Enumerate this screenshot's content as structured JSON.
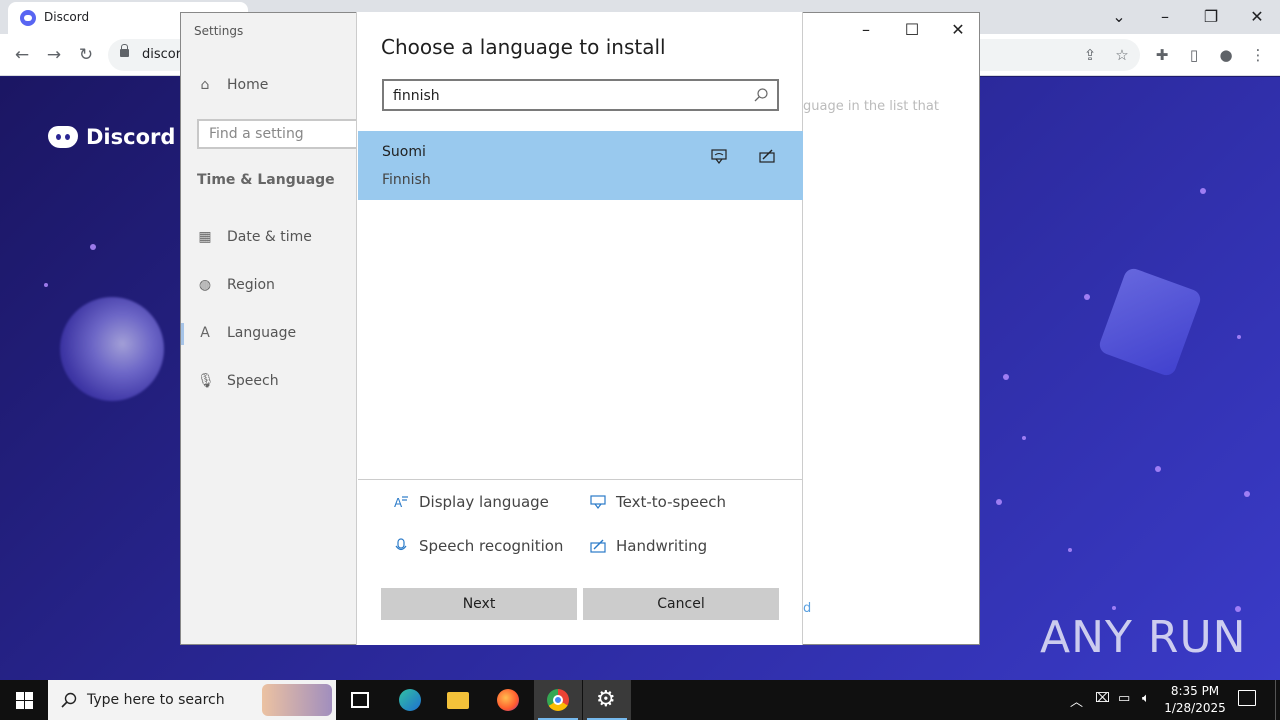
{
  "browser": {
    "tab_title": "Discord",
    "url": "discor"
  },
  "discord": {
    "logo_text": "Discord",
    "watermark": "ANY RUN"
  },
  "settings": {
    "title": "Settings",
    "nav": {
      "home": "Home",
      "search_placeholder": "Find a setting",
      "section": "Time & Language",
      "items": [
        {
          "label": "Date & time",
          "icon": "calendar-clock-icon"
        },
        {
          "label": "Region",
          "icon": "globe-icon"
        },
        {
          "label": "Language",
          "icon": "language-icon"
        },
        {
          "label": "Speech",
          "icon": "microphone-icon"
        }
      ]
    },
    "background_text": "guage in the list that",
    "background_link": "d"
  },
  "dialog": {
    "title": "Choose a language to install",
    "search_value": "finnish",
    "results": [
      {
        "native": "Suomi",
        "english": "Finnish",
        "features": [
          "text-to-speech-icon",
          "handwriting-icon"
        ]
      }
    ],
    "legend": {
      "display_language": "Display language",
      "text_to_speech": "Text-to-speech",
      "speech_recognition": "Speech recognition",
      "handwriting": "Handwriting"
    },
    "buttons": {
      "next": "Next",
      "cancel": "Cancel"
    }
  },
  "taskbar": {
    "search_placeholder": "Type here to search",
    "time": "8:35 PM",
    "date": "1/28/2025"
  },
  "colors": {
    "selected_row": "#99c9ee",
    "button_gray": "#cccccc",
    "discord_blurple": "#5865f2"
  }
}
